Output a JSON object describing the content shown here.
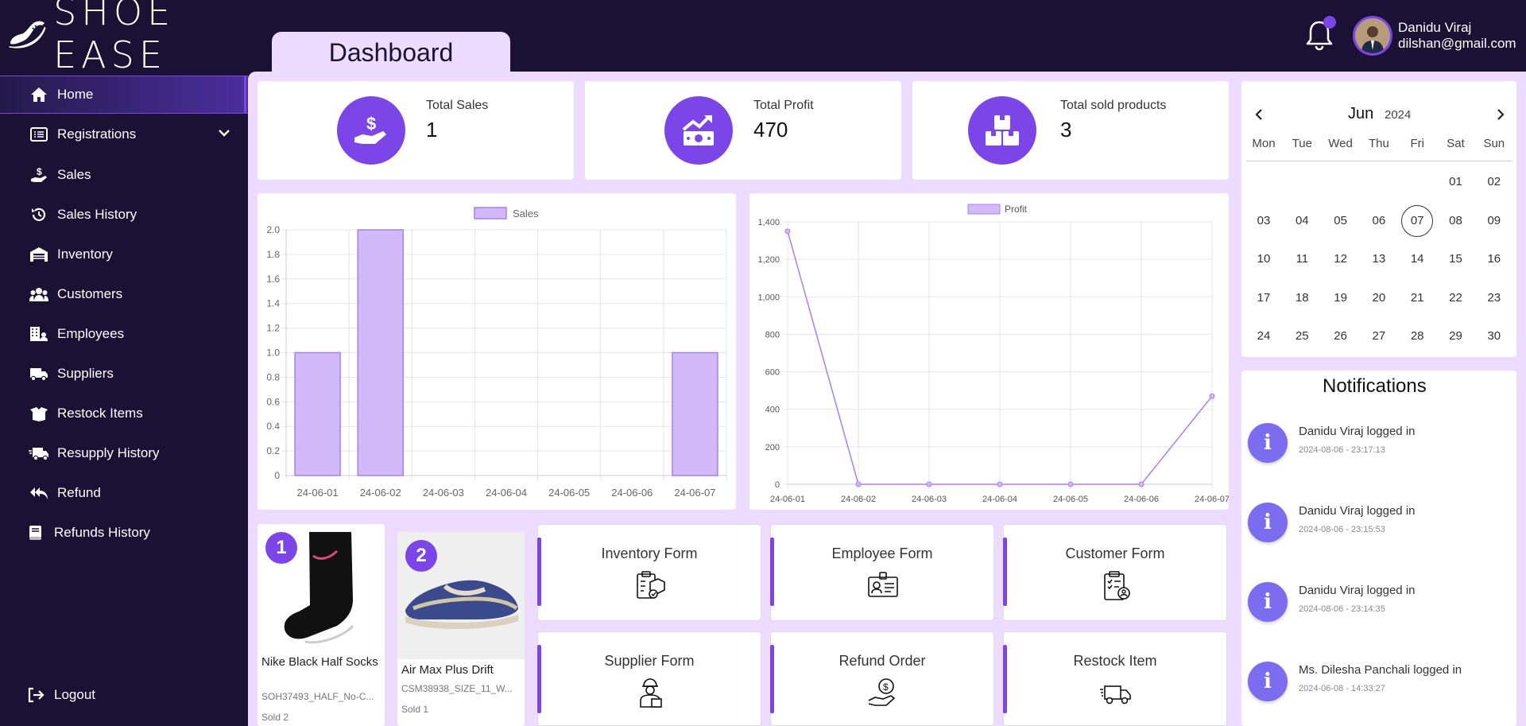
{
  "app": {
    "brand": "SHOE EASE",
    "page_title": "Dashboard"
  },
  "user": {
    "name": "Danidu Viraj",
    "email": "dilshan@gmail.com"
  },
  "sidebar": {
    "items": [
      {
        "label": "Home",
        "icon": "home-icon"
      },
      {
        "label": "Registrations",
        "icon": "list-icon"
      },
      {
        "label": "Sales",
        "icon": "hand-dollar-icon"
      },
      {
        "label": "Sales History",
        "icon": "history-icon"
      },
      {
        "label": "Inventory",
        "icon": "warehouse-icon"
      },
      {
        "label": "Customers",
        "icon": "users-icon"
      },
      {
        "label": "Employees",
        "icon": "building-user-icon"
      },
      {
        "label": "Suppliers",
        "icon": "truck-icon"
      },
      {
        "label": "Restock Items",
        "icon": "box-open-icon"
      },
      {
        "label": "Resupply History",
        "icon": "truck-fast-icon"
      },
      {
        "label": "Refund",
        "icon": "reply-all-icon"
      },
      {
        "label": "Refunds History",
        "icon": "book-icon"
      }
    ],
    "logout": "Logout"
  },
  "stats": [
    {
      "label": "Total Sales",
      "value": "1",
      "icon": "hand-dollar-icon"
    },
    {
      "label": "Total Profit",
      "value": "470",
      "icon": "chart-money-icon"
    },
    {
      "label": "Total sold products",
      "value": "3",
      "icon": "boxes-icon"
    }
  ],
  "chart_data": [
    {
      "type": "bar",
      "categories": [
        "24-06-01",
        "24-06-02",
        "24-06-03",
        "24-06-04",
        "24-06-05",
        "24-06-06",
        "24-06-07"
      ],
      "series": [
        {
          "name": "Sales",
          "values": [
            1,
            2,
            0,
            0,
            0,
            0,
            1
          ]
        }
      ],
      "ylim": [
        0,
        2.0
      ],
      "yticks": [
        "0",
        "0.2",
        "0.4",
        "0.6",
        "0.8",
        "1.0",
        "1.2",
        "1.4",
        "1.6",
        "1.8",
        "2.0"
      ],
      "grid": true,
      "legend": "top-center",
      "color": "#d1b9fa",
      "border_color": "#a97ef0"
    },
    {
      "type": "line",
      "categories": [
        "24-06-01",
        "24-06-02",
        "24-06-03",
        "24-06-04",
        "24-06-05",
        "24-06-06",
        "24-06-07"
      ],
      "series": [
        {
          "name": "Profit",
          "values": [
            1350,
            0,
            0,
            0,
            0,
            0,
            470
          ]
        }
      ],
      "ylim": [
        0,
        1400
      ],
      "yticks": [
        "0",
        "200",
        "400",
        "600",
        "800",
        "1,000",
        "1,200",
        "1,400"
      ],
      "grid": true,
      "legend": "top-center",
      "color": "#a97ef0"
    }
  ],
  "calendar": {
    "month": "Jun",
    "year": "2024",
    "weekdays": [
      "Mon",
      "Tue",
      "Wed",
      "Thu",
      "Fri",
      "Sat",
      "Sun"
    ],
    "days": [
      "01",
      "02",
      "03",
      "04",
      "05",
      "06",
      "07",
      "08",
      "09",
      "10",
      "11",
      "12",
      "13",
      "14",
      "15",
      "16",
      "17",
      "18",
      "19",
      "20",
      "21",
      "22",
      "23",
      "24",
      "25",
      "26",
      "27",
      "28",
      "29",
      "30"
    ],
    "today": "07"
  },
  "notifications": {
    "title": "Notifications",
    "items": [
      {
        "text": "Danidu Viraj logged in",
        "time": "2024-08-06 - 23:17:13"
      },
      {
        "text": "Danidu Viraj logged in",
        "time": "2024-08-06 - 23:15:53"
      },
      {
        "text": "Danidu Viraj logged in",
        "time": "2024-08-06 - 23:14:35"
      },
      {
        "text": "Ms. Dilesha Panchali logged in",
        "time": "2024-06-08 - 14:33:27"
      }
    ]
  },
  "top_products": [
    {
      "rank": "1",
      "name": "Nike Black Half Socks",
      "code": "SOH37493_HALF_No-C...",
      "sold": "Sold 2"
    },
    {
      "rank": "2",
      "name": "Air Max Plus Drift",
      "code": "CSM38938_SIZE_11_W...",
      "sold": "Sold 1"
    }
  ],
  "quick_forms": [
    {
      "label": "Inventory Form",
      "icon": "clipboard-box-icon"
    },
    {
      "label": "Employee Form",
      "icon": "id-card-icon"
    },
    {
      "label": "Customer Form",
      "icon": "clipboard-user-icon"
    },
    {
      "label": "Supplier Form",
      "icon": "delivery-person-icon"
    },
    {
      "label": "Refund Order",
      "icon": "hand-coin-icon"
    },
    {
      "label": "Restock Item",
      "icon": "delivery-truck-icon"
    }
  ]
}
